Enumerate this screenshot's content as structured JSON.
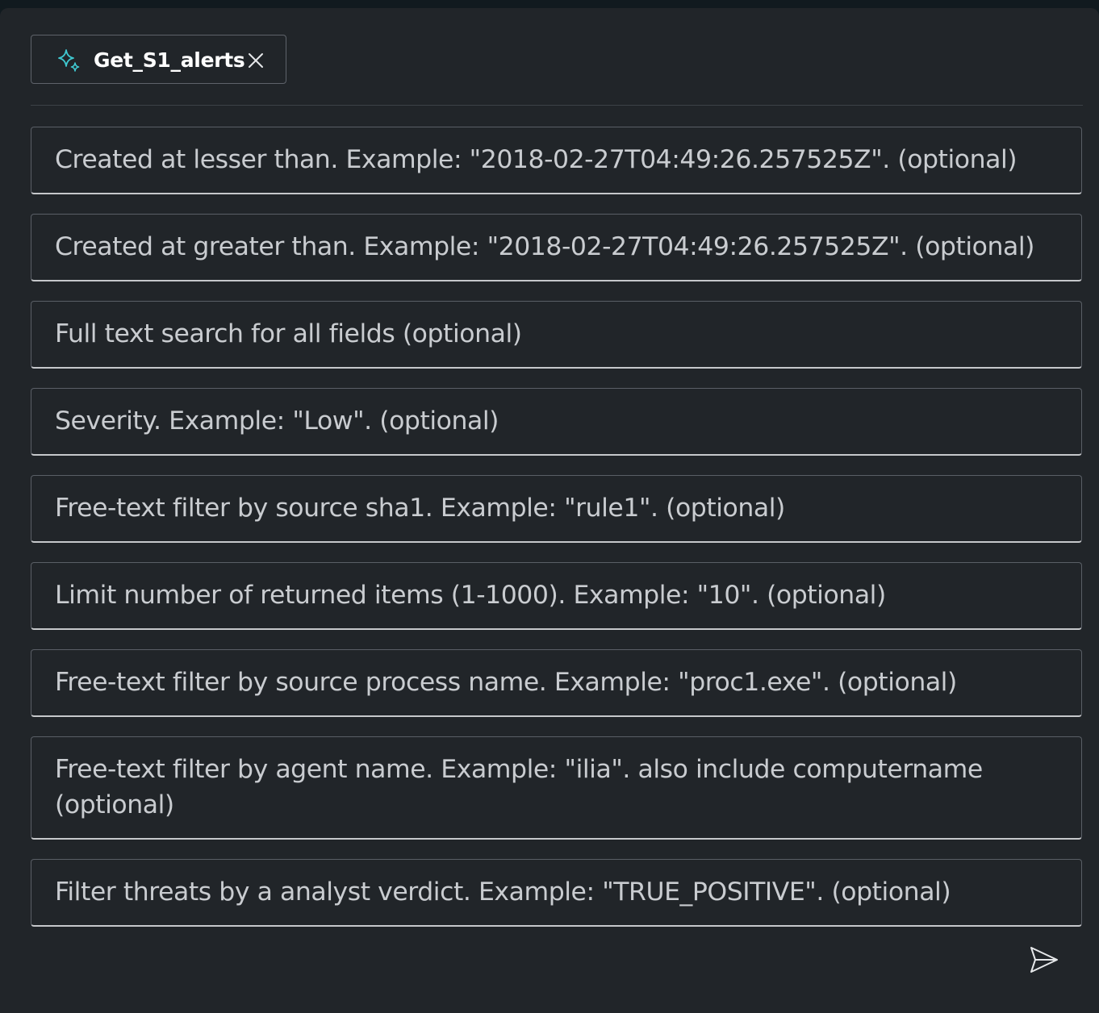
{
  "chip": {
    "icon": "sparkle-icon",
    "label": "Get_S1_alerts",
    "close_icon": "close-icon"
  },
  "fields": [
    {
      "name": "created-lt-field",
      "placeholder": "Created at lesser than. Example: \"2018-02-27T04:49:26.257525Z\". (optional)"
    },
    {
      "name": "created-gt-field",
      "placeholder": "Created at greater than. Example: \"2018-02-27T04:49:26.257525Z\". (optional)"
    },
    {
      "name": "full-text-search-field",
      "placeholder": "Full text search for all fields (optional)"
    },
    {
      "name": "severity-field",
      "placeholder": "Severity. Example: \"Low\". (optional)"
    },
    {
      "name": "source-sha1-field",
      "placeholder": "Free-text filter by source sha1. Example: \"rule1\". (optional)"
    },
    {
      "name": "limit-field",
      "placeholder": "Limit number of returned items (1-1000). Example: \"10\". (optional)"
    },
    {
      "name": "source-process-name-field",
      "placeholder": "Free-text filter by source process name. Example: \"proc1.exe\". (optional)"
    },
    {
      "name": "agent-name-field",
      "placeholder": "Free-text filter by agent name. Example: \"ilia\". also include computername (optional)"
    },
    {
      "name": "analyst-verdict-field",
      "placeholder": "Filter threats by a analyst verdict. Example: \"TRUE_POSITIVE\". (optional)"
    }
  ],
  "send_icon": "send-icon",
  "colors": {
    "background": "#212529",
    "accent_icon": "#3fc8d0",
    "text": "#c9ccd0"
  }
}
